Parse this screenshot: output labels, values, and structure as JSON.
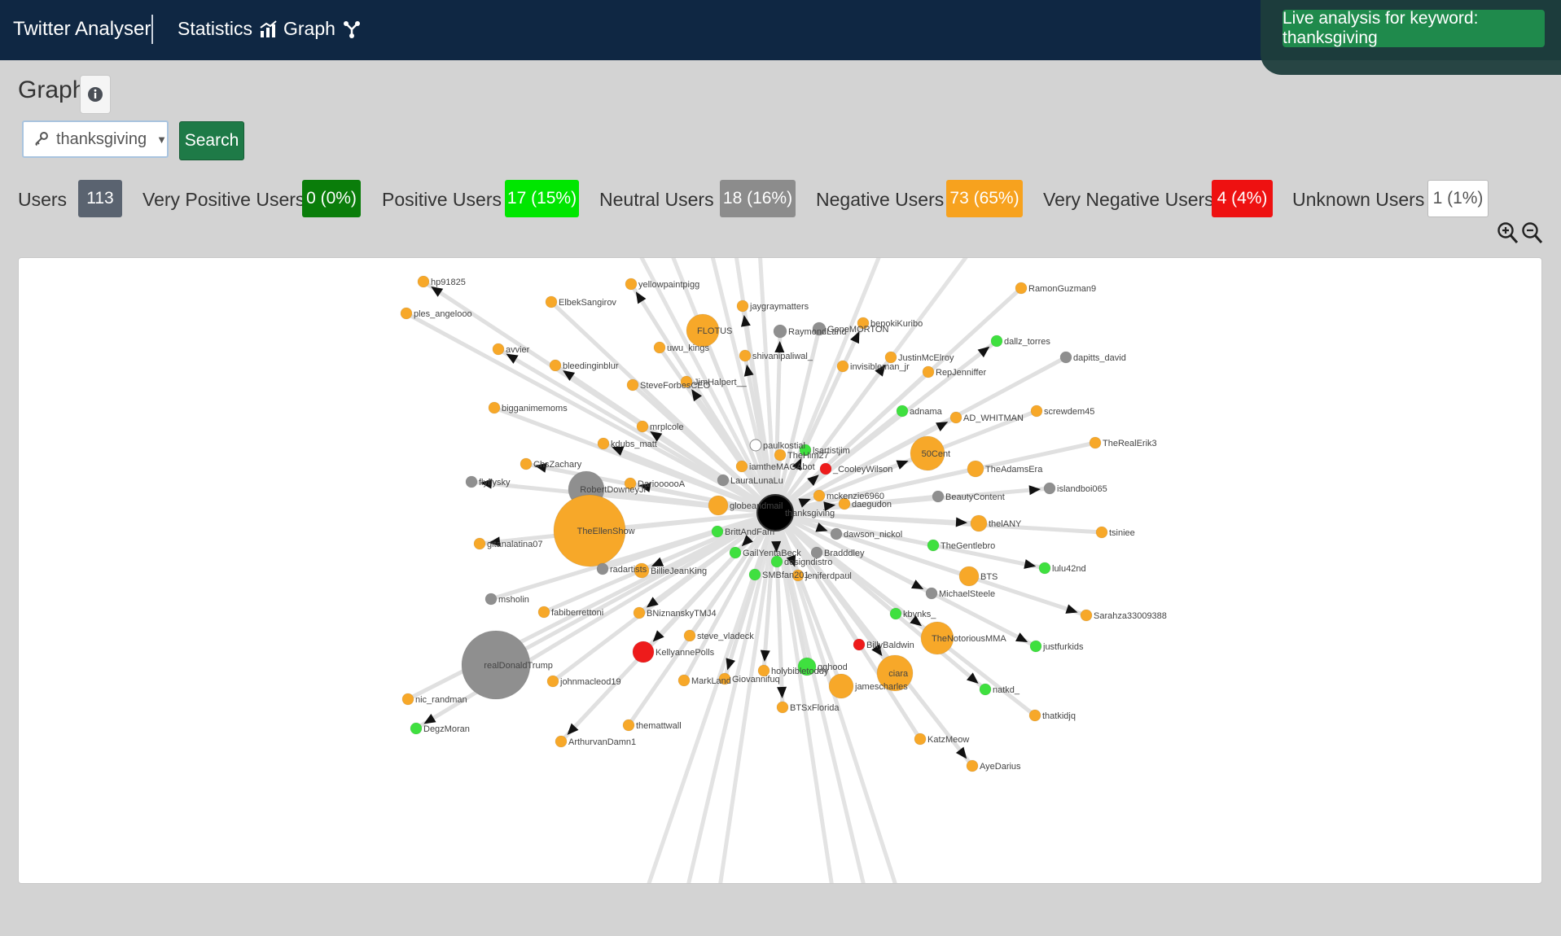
{
  "navbar": {
    "brand": "Twitter Analyser",
    "statistics_label": "Statistics",
    "graph_label": "Graph",
    "live_badge": "Live analysis for keyword: thanksgiving"
  },
  "page": {
    "title": "Graph",
    "keyword_select_value": "thanksgiving",
    "search_label": "Search"
  },
  "stats": [
    {
      "label": "Users",
      "value": "113",
      "color": "#5a6370",
      "text_color": "#ffffff"
    },
    {
      "label": "Very Positive Users",
      "value": "0 (0%)",
      "color": "#0a7d0a",
      "text_color": "#ffffff"
    },
    {
      "label": "Positive Users",
      "value": "17 (15%)",
      "color": "#00e600",
      "text_color": "#ffffff"
    },
    {
      "label": "Neutral Users",
      "value": "18 (16%)",
      "color": "#8c8c8c",
      "text_color": "#ffffff"
    },
    {
      "label": "Negative Users",
      "value": "73 (65%)",
      "color": "#f7a21e",
      "text_color": "#ffffff"
    },
    {
      "label": "Very Negative Users",
      "value": "4 (4%)",
      "color": "#ee1111",
      "text_color": "#ffffff"
    },
    {
      "label": "Unknown Users",
      "value": "1 (1%)",
      "color": "#ffffff",
      "text_color": "#555555"
    }
  ],
  "icons": {
    "statistics": "bar-chart-icon",
    "graph": "graph-network-icon",
    "info": "info-icon",
    "keyword": "key-icon",
    "zoom_in": "zoom-in-icon",
    "zoom_out": "zoom-out-icon"
  },
  "sentiment_colors": {
    "negative": "#f7a829",
    "positive": "#3fe03f",
    "neutral": "#8f8f8f",
    "very_negative": "#ee1b1b",
    "unknown": "#ffffff",
    "center": "#000000"
  },
  "graph": {
    "center": {
      "label": "thanksgiving"
    },
    "nodes": [
      {
        "label": "hp91825",
        "s": "negative"
      },
      {
        "label": "ples_angelooo",
        "s": "negative"
      },
      {
        "label": "yellowpaintpigg",
        "s": "negative"
      },
      {
        "label": "ElbekSangirov",
        "s": "negative"
      },
      {
        "label": "jaygraymatters",
        "s": "negative"
      },
      {
        "label": "FLOTUS",
        "s": "negative"
      },
      {
        "label": "RaymondLand",
        "s": "neutral"
      },
      {
        "label": "GeneMORTON",
        "s": "neutral"
      },
      {
        "label": "bepokiKuribo",
        "s": "negative"
      },
      {
        "label": "RamonGuzman9",
        "s": "negative"
      },
      {
        "label": "dallz_torres",
        "s": "positive"
      },
      {
        "label": "dapitts_david",
        "s": "neutral"
      },
      {
        "label": "avvier",
        "s": "negative"
      },
      {
        "label": "uwu_kings",
        "s": "negative"
      },
      {
        "label": "shivanipaliwal_",
        "s": "negative"
      },
      {
        "label": "invisibleman_jr",
        "s": "negative"
      },
      {
        "label": "JustinMcElroy",
        "s": "negative"
      },
      {
        "label": "RepJenniffer",
        "s": "negative"
      },
      {
        "label": "bleedinginblur",
        "s": "negative"
      },
      {
        "label": "SteveForbesCEO",
        "s": "negative"
      },
      {
        "label": "JimHalpert__",
        "s": "negative"
      },
      {
        "label": "bigganimemoms",
        "s": "negative"
      },
      {
        "label": "mrplcole",
        "s": "negative"
      },
      {
        "label": "adnama",
        "s": "positive"
      },
      {
        "label": "AD_WHITMAN",
        "s": "negative"
      },
      {
        "label": "screwdem45",
        "s": "negative"
      },
      {
        "label": "kdubs_matt",
        "s": "negative"
      },
      {
        "label": "paulkostial",
        "s": "unknown"
      },
      {
        "label": "lsartistjim",
        "s": "positive"
      },
      {
        "label": "TheHim27",
        "s": "negative"
      },
      {
        "label": "50Cent",
        "s": "negative"
      },
      {
        "label": "TheRealErik3",
        "s": "negative"
      },
      {
        "label": "ChsZachary",
        "s": "negative"
      },
      {
        "label": "iamtheMAGAbot",
        "s": "negative"
      },
      {
        "label": "_CooleyWilson",
        "s": "very_negative"
      },
      {
        "label": "TheAdamsEra",
        "s": "negative"
      },
      {
        "label": "flyflysky",
        "s": "neutral"
      },
      {
        "label": "RobertDowneyJr",
        "s": "neutral"
      },
      {
        "label": "DarioooooA",
        "s": "negative"
      },
      {
        "label": "LauraLunaLu",
        "s": "neutral"
      },
      {
        "label": "mckenzie6960",
        "s": "negative"
      },
      {
        "label": "BeautyContent",
        "s": "neutral"
      },
      {
        "label": "islandboi065",
        "s": "neutral"
      },
      {
        "label": "globeandmail",
        "s": "negative"
      },
      {
        "label": "daegudon",
        "s": "negative"
      },
      {
        "label": "TheEllenShow",
        "s": "negative"
      },
      {
        "label": "thelANY",
        "s": "negative"
      },
      {
        "label": "tsiniee",
        "s": "negative"
      },
      {
        "label": "gitanalatina07",
        "s": "negative"
      },
      {
        "label": "BrittAndFam",
        "s": "positive"
      },
      {
        "label": "dawson_nickol",
        "s": "neutral"
      },
      {
        "label": "TheGentlebro",
        "s": "positive"
      },
      {
        "label": "GailYentaBeck",
        "s": "positive"
      },
      {
        "label": "Bradddley",
        "s": "neutral"
      },
      {
        "label": "designdistro",
        "s": "positive"
      },
      {
        "label": "radartists",
        "s": "neutral"
      },
      {
        "label": "BillieJeanKing",
        "s": "negative"
      },
      {
        "label": "SMBfan201",
        "s": "positive"
      },
      {
        "label": "jeniferdpaul",
        "s": "negative"
      },
      {
        "label": "BTS",
        "s": "negative"
      },
      {
        "label": "lulu42nd",
        "s": "positive"
      },
      {
        "label": "msholin",
        "s": "neutral"
      },
      {
        "label": "MichaelSteele",
        "s": "neutral"
      },
      {
        "label": "fabiberrettoni",
        "s": "negative"
      },
      {
        "label": "BNiznanskyTMJ4",
        "s": "negative"
      },
      {
        "label": "kbvnks_",
        "s": "positive"
      },
      {
        "label": "Sarahza33009388",
        "s": "negative"
      },
      {
        "label": "steve_vladeck",
        "s": "negative"
      },
      {
        "label": "TheNotoriousMMA",
        "s": "negative"
      },
      {
        "label": "realDonaldTrump",
        "s": "neutral"
      },
      {
        "label": "KellyannePolls",
        "s": "very_negative"
      },
      {
        "label": "BillyBaldwin",
        "s": "very_negative"
      },
      {
        "label": "justfurkids",
        "s": "positive"
      },
      {
        "label": "johnmacleod19",
        "s": "negative"
      },
      {
        "label": "holybibletoddy",
        "s": "negative"
      },
      {
        "label": "gghood",
        "s": "positive"
      },
      {
        "label": "ciara",
        "s": "negative"
      },
      {
        "label": "MarkLand",
        "s": "negative"
      },
      {
        "label": "Giovannifuq",
        "s": "negative"
      },
      {
        "label": "jamescharles",
        "s": "negative"
      },
      {
        "label": "natkd_",
        "s": "positive"
      },
      {
        "label": "nic_randman",
        "s": "negative"
      },
      {
        "label": "BTSxFlorida",
        "s": "negative"
      },
      {
        "label": "thatkidjq",
        "s": "negative"
      },
      {
        "label": "DegzMoran",
        "s": "positive"
      },
      {
        "label": "themattwall",
        "s": "negative"
      },
      {
        "label": "ArthurvanDamn1",
        "s": "negative"
      },
      {
        "label": "KatzMeow",
        "s": "negative"
      },
      {
        "label": "AyeDarius",
        "s": "negative"
      }
    ]
  }
}
